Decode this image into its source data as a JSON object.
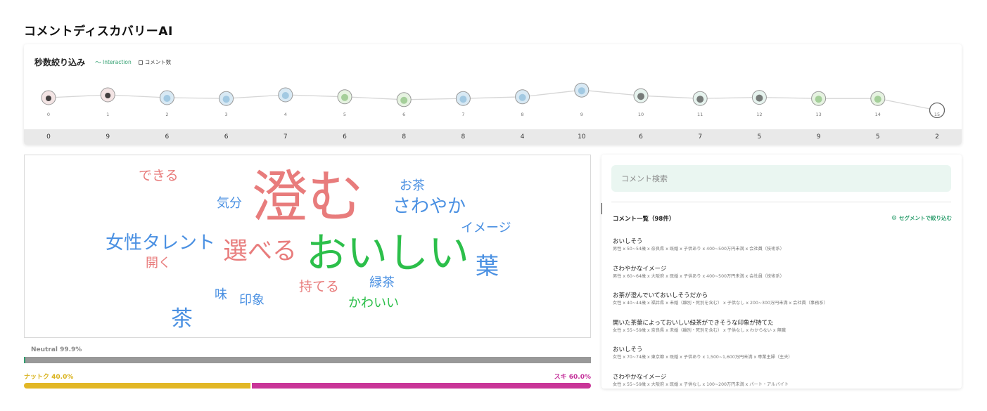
{
  "page": {
    "title": "コメントディスカバリーAI"
  },
  "timeline": {
    "title": "秒数絞り込み",
    "legend_interaction": "Interaction",
    "legend_comment": "コメント数",
    "interaction_color": "#2e9e6e",
    "seconds": [
      "0",
      "1",
      "2",
      "3",
      "4",
      "5",
      "6",
      "7",
      "8",
      "9",
      "10",
      "11",
      "12",
      "13",
      "14",
      "15"
    ],
    "counts": [
      "0",
      "9",
      "6",
      "6",
      "7",
      "6",
      "8",
      "8",
      "4",
      "10",
      "6",
      "7",
      "5",
      "9",
      "5",
      "2"
    ],
    "interaction_levels": [
      0.45,
      0.55,
      0.45,
      0.42,
      0.55,
      0.48,
      0.38,
      0.42,
      0.48,
      0.72,
      0.52,
      0.42,
      0.46,
      0.42,
      0.42,
      0.0
    ],
    "thumbnail_kinds": [
      "person",
      "person",
      "glass",
      "glass",
      "glass",
      "leaf",
      "leaf",
      "glass",
      "glass",
      "glass",
      "bottle",
      "bottle",
      "bottle",
      "leaf",
      "leaf",
      "empty"
    ]
  },
  "word_cloud": {
    "words": [
      {
        "text": "澄む",
        "color": "#e87c7c"
      },
      {
        "text": "おいしい",
        "color": "#2cbf4a"
      },
      {
        "text": "選べる",
        "color": "#e87c7c"
      },
      {
        "text": "女性タレント",
        "color": "#4a90e2"
      },
      {
        "text": "さわやか",
        "color": "#4a90e2"
      },
      {
        "text": "葉",
        "color": "#4a90e2"
      },
      {
        "text": "茶",
        "color": "#4a90e2"
      },
      {
        "text": "できる",
        "color": "#e87c7c"
      },
      {
        "text": "お茶",
        "color": "#4a90e2"
      },
      {
        "text": "気分",
        "color": "#4a90e2"
      },
      {
        "text": "イメージ",
        "color": "#4a90e2"
      },
      {
        "text": "開く",
        "color": "#e87c7c"
      },
      {
        "text": "持てる",
        "color": "#e87c7c"
      },
      {
        "text": "緑茶",
        "color": "#4a90e2"
      },
      {
        "text": "味",
        "color": "#4a90e2"
      },
      {
        "text": "印象",
        "color": "#4a90e2"
      },
      {
        "text": "かわいい",
        "color": "#2cbf4a"
      }
    ]
  },
  "sentiment": {
    "neutral_label": "Neutral 99.9%",
    "neutral_value": 0.999,
    "negative_label": "ナットク 40.0%",
    "negative_value": 0.4,
    "positive_label": "スキ 60.0%",
    "positive_value": 0.6,
    "negative_color": "#e2b726",
    "positive_color": "#c93598"
  },
  "comments": {
    "search_placeholder": "コメント検索",
    "header": "コメント一覧（98件）",
    "segment_link": "セグメントで絞り込む",
    "items": [
      {
        "text": "おいしそう",
        "meta": "男性 x 50~54歳 x 奈良県 x 既婚 x 子供あり x 400~500万円未満 x 会社員（技術系）"
      },
      {
        "text": "さわやかなイメージ",
        "meta": "男性 x 60~64歳 x 大阪府 x 既婚 x 子供あり x 400~500万円未満 x 会社員（技術系）"
      },
      {
        "text": "お茶が澄んでいておいしそうだから",
        "meta": "女性 x 40~44歳 x 福井県 x 未婚（離別・死別を含む） x 子供なし x 200~300万円未満 x 会社員（事務系）"
      },
      {
        "text": "開いた茶葉によっておいしい緑茶ができそうな印象が持てた",
        "meta": "女性 x 55~59歳 x 奈良県 x 未婚（離別・死別を含む） x 子供なし x わからない x 無職"
      },
      {
        "text": "おいしそう",
        "meta": "女性 x 70~74歳 x 東京都 x 既婚 x 子供あり x 1,500~1,600万円未満 x 専業主婦（主夫）"
      },
      {
        "text": "さわやかなイメージ",
        "meta": "女性 x 55~59歳 x 大阪府 x 既婚 x 子供なし x 100~200万円未満 x パート・アルバイト"
      }
    ]
  }
}
